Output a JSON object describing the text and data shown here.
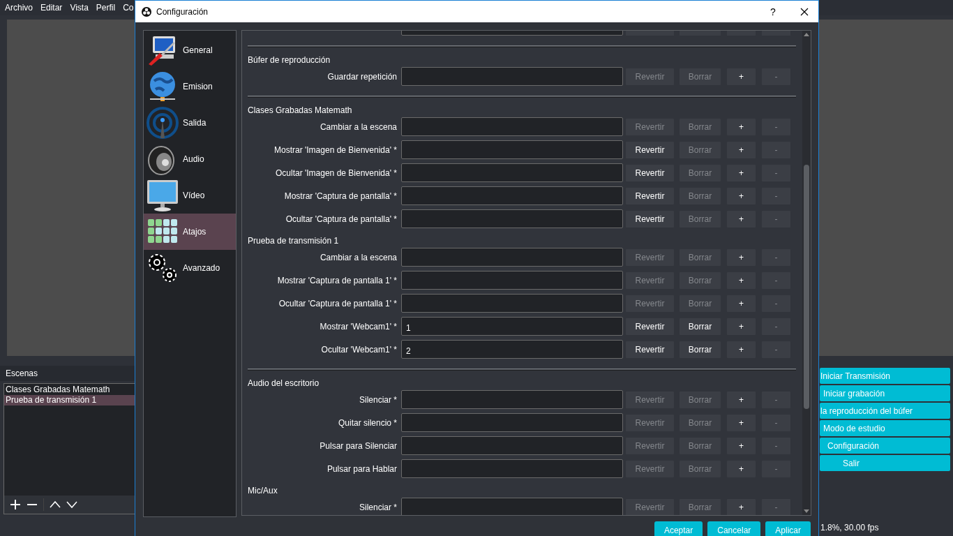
{
  "menu": [
    "Archivo",
    "Editar",
    "Vista",
    "Perfil",
    "Co"
  ],
  "scenes": {
    "title": "Escenas",
    "items": [
      {
        "label": "Clases Grabadas Matemath",
        "selected": false
      },
      {
        "label": "Prueba de transmisión 1",
        "selected": true
      }
    ]
  },
  "controls": [
    "Iniciar Transmisión",
    "Iniciar grabación",
    "la reproducción del búfer",
    "Modo de estudio",
    "Configuración",
    "Salir"
  ],
  "status": "1.8%, 30.00 fps",
  "dialog": {
    "title": "Configuración",
    "help": "?",
    "sidebar": [
      {
        "label": "General",
        "kind": "general",
        "selected": false
      },
      {
        "label": "Emision",
        "kind": "stream",
        "selected": false
      },
      {
        "label": "Salida",
        "kind": "output",
        "selected": false
      },
      {
        "label": "Audio",
        "kind": "audio",
        "selected": false
      },
      {
        "label": "Vídeo",
        "kind": "video",
        "selected": false
      },
      {
        "label": "Atajos",
        "kind": "hotkeys",
        "selected": true
      },
      {
        "label": "Avanzado",
        "kind": "advanced",
        "selected": false
      }
    ],
    "groups": [
      {
        "title": "Búfer de reproducción",
        "separator": true,
        "rows": [
          {
            "label": "Guardar repetición",
            "buttons": [
              {
                "label": "Revertir",
                "disabled": true
              },
              {
                "label": "Borrar",
                "disabled": true
              },
              {
                "label": "+",
                "disabled": false
              },
              {
                "label": "-",
                "disabled": true
              }
            ]
          }
        ]
      },
      {
        "title": "Clases Grabadas Matemath",
        "separator": true,
        "rows": [
          {
            "label": "Cambiar a la escena",
            "buttons": [
              {
                "label": "Revertir",
                "disabled": true
              },
              {
                "label": "Borrar",
                "disabled": true
              },
              {
                "label": "+",
                "disabled": false
              },
              {
                "label": "-",
                "disabled": true
              }
            ]
          },
          {
            "label": "Mostrar 'Imagen de Bienvenida' *",
            "buttons": [
              {
                "label": "Revertir",
                "disabled": false
              },
              {
                "label": "Borrar",
                "disabled": true
              },
              {
                "label": "+",
                "disabled": false
              },
              {
                "label": "-",
                "disabled": true
              }
            ]
          },
          {
            "label": "Ocultar 'Imagen de Bienvenida' *",
            "buttons": [
              {
                "label": "Revertir",
                "disabled": false
              },
              {
                "label": "Borrar",
                "disabled": true
              },
              {
                "label": "+",
                "disabled": false
              },
              {
                "label": "-",
                "disabled": true
              }
            ]
          },
          {
            "label": "Mostrar 'Captura de pantalla' *",
            "buttons": [
              {
                "label": "Revertir",
                "disabled": false
              },
              {
                "label": "Borrar",
                "disabled": true
              },
              {
                "label": "+",
                "disabled": false
              },
              {
                "label": "-",
                "disabled": true
              }
            ]
          },
          {
            "label": "Ocultar 'Captura de pantalla' *",
            "buttons": [
              {
                "label": "Revertir",
                "disabled": false
              },
              {
                "label": "Borrar",
                "disabled": true
              },
              {
                "label": "+",
                "disabled": false
              },
              {
                "label": "-",
                "disabled": true
              }
            ]
          }
        ]
      },
      {
        "title": "Prueba de transmisión 1",
        "separator": false,
        "rows": [
          {
            "label": "Cambiar a la escena",
            "buttons": [
              {
                "label": "Revertir",
                "disabled": true
              },
              {
                "label": "Borrar",
                "disabled": true
              },
              {
                "label": "+",
                "disabled": false
              },
              {
                "label": "-",
                "disabled": true
              }
            ]
          },
          {
            "label": "Mostrar 'Captura de pantalla 1' *",
            "buttons": [
              {
                "label": "Revertir",
                "disabled": true
              },
              {
                "label": "Borrar",
                "disabled": true
              },
              {
                "label": "+",
                "disabled": false
              },
              {
                "label": "-",
                "disabled": true
              }
            ]
          },
          {
            "label": "Ocultar 'Captura de pantalla 1' *",
            "buttons": [
              {
                "label": "Revertir",
                "disabled": true
              },
              {
                "label": "Borrar",
                "disabled": true
              },
              {
                "label": "+",
                "disabled": false
              },
              {
                "label": "-",
                "disabled": true
              }
            ]
          },
          {
            "label": "Mostrar 'Webcam1' *",
            "value": "1",
            "buttons": [
              {
                "label": "Revertir",
                "disabled": false
              },
              {
                "label": "Borrar",
                "disabled": false
              },
              {
                "label": "+",
                "disabled": false
              },
              {
                "label": "-",
                "disabled": true
              }
            ]
          },
          {
            "label": "Ocultar 'Webcam1' *",
            "value": "2",
            "buttons": [
              {
                "label": "Revertir",
                "disabled": false
              },
              {
                "label": "Borrar",
                "disabled": false
              },
              {
                "label": "+",
                "disabled": false
              },
              {
                "label": "-",
                "disabled": true
              }
            ]
          }
        ]
      },
      {
        "title": "Audio del escritorio",
        "separator": true,
        "rows": [
          {
            "label": "Silenciar *",
            "buttons": [
              {
                "label": "Revertir",
                "disabled": true
              },
              {
                "label": "Borrar",
                "disabled": true
              },
              {
                "label": "+",
                "disabled": false
              },
              {
                "label": "-",
                "disabled": true
              }
            ]
          },
          {
            "label": "Quitar silencio *",
            "buttons": [
              {
                "label": "Revertir",
                "disabled": true
              },
              {
                "label": "Borrar",
                "disabled": true
              },
              {
                "label": "+",
                "disabled": false
              },
              {
                "label": "-",
                "disabled": true
              }
            ]
          },
          {
            "label": "Pulsar para Silenciar",
            "buttons": [
              {
                "label": "Revertir",
                "disabled": true
              },
              {
                "label": "Borrar",
                "disabled": true
              },
              {
                "label": "+",
                "disabled": false
              },
              {
                "label": "-",
                "disabled": true
              }
            ]
          },
          {
            "label": "Pulsar para Hablar",
            "buttons": [
              {
                "label": "Revertir",
                "disabled": true
              },
              {
                "label": "Borrar",
                "disabled": true
              },
              {
                "label": "+",
                "disabled": false
              },
              {
                "label": "-",
                "disabled": true
              }
            ]
          }
        ]
      },
      {
        "title": "Mic/Aux",
        "separator": false,
        "rows": [
          {
            "label": "Silenciar *",
            "buttons": [
              {
                "label": "Revertir",
                "disabled": true
              },
              {
                "label": "Borrar",
                "disabled": true
              },
              {
                "label": "+",
                "disabled": false
              },
              {
                "label": "-",
                "disabled": true
              }
            ]
          }
        ]
      }
    ],
    "footer": [
      "Aceptar",
      "Cancelar",
      "Aplicar"
    ]
  }
}
